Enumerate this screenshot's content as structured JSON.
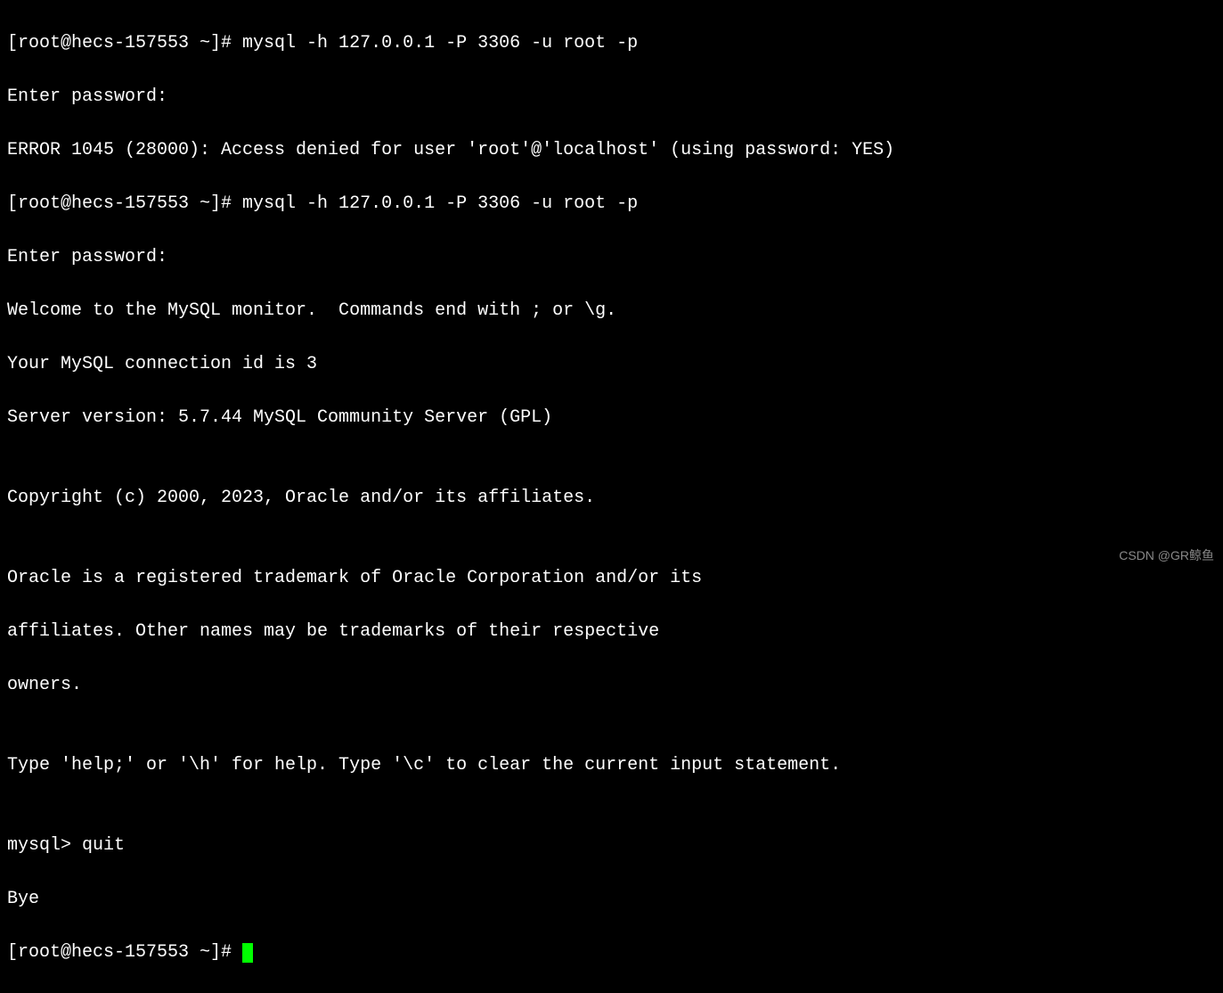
{
  "lines": {
    "l0": "[root@hecs-157553 ~]# mysql -h 127.0.0.1 -P 3306 -u root -p",
    "l1": "Enter password:",
    "l2": "ERROR 1045 (28000): Access denied for user 'root'@'localhost' (using password: YES)",
    "l3": "[root@hecs-157553 ~]# mysql -h 127.0.0.1 -P 3306 -u root -p",
    "l4": "Enter password:",
    "l5": "Welcome to the MySQL monitor.  Commands end with ; or \\g.",
    "l6": "Your MySQL connection id is 3",
    "l7": "Server version: 5.7.44 MySQL Community Server (GPL)",
    "l8": "",
    "l9": "Copyright (c) 2000, 2023, Oracle and/or its affiliates.",
    "l10": "",
    "l11": "Oracle is a registered trademark of Oracle Corporation and/or its",
    "l12": "affiliates. Other names may be trademarks of their respective",
    "l13": "owners.",
    "l14": "",
    "l15": "Type 'help;' or '\\h' for help. Type '\\c' to clear the current input statement.",
    "l16": "",
    "l17": "mysql> quit",
    "l18": "Bye",
    "l19": "[root@hecs-157553 ~]# "
  },
  "watermark": "CSDN @GR鲸鱼"
}
